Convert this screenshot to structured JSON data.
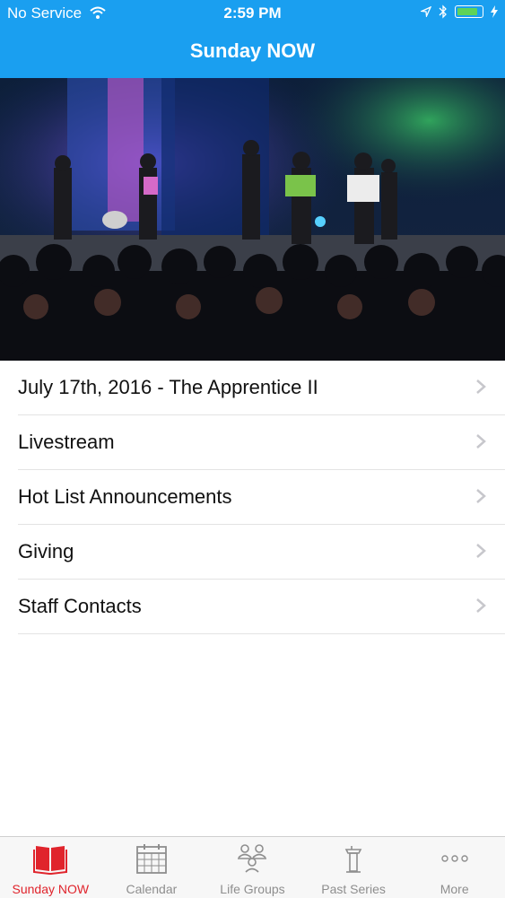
{
  "status_bar": {
    "carrier": "No Service",
    "time": "2:59 PM"
  },
  "header": {
    "title": "Sunday NOW"
  },
  "hero": {
    "description": "Worship band performing on stage with congregation"
  },
  "menu": [
    {
      "label": "July 17th, 2016 - The Apprentice II"
    },
    {
      "label": "Livestream"
    },
    {
      "label": "Hot List Announcements"
    },
    {
      "label": "Giving"
    },
    {
      "label": "Staff Contacts"
    }
  ],
  "tabs": [
    {
      "label": "Sunday NOW",
      "icon": "book-icon",
      "active": true
    },
    {
      "label": "Calendar",
      "icon": "calendar-icon",
      "active": false
    },
    {
      "label": "Life Groups",
      "icon": "people-icon",
      "active": false
    },
    {
      "label": "Past Series",
      "icon": "podium-icon",
      "active": false
    },
    {
      "label": "More",
      "icon": "more-icon",
      "active": false
    }
  ],
  "colors": {
    "header": "#1a9ff0",
    "active_tab": "#e0242c",
    "inactive_tab": "#8e8e8e"
  }
}
